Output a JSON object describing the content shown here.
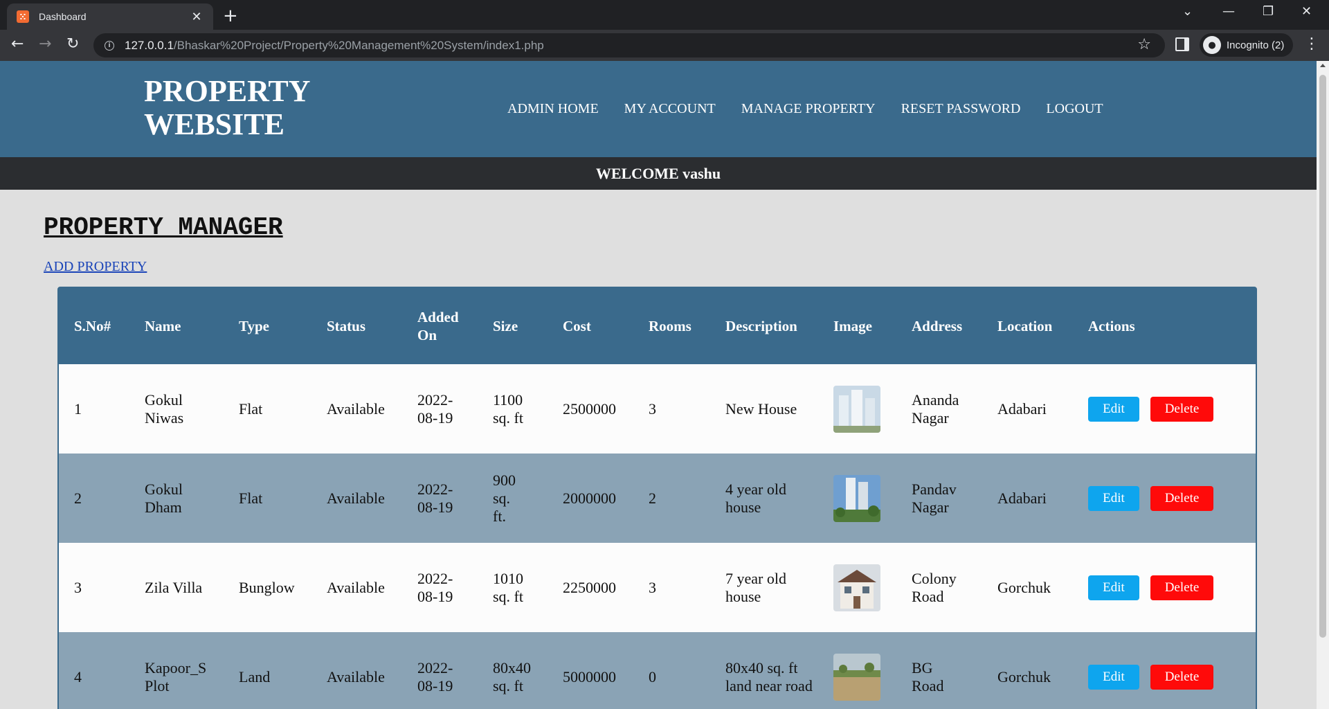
{
  "browser": {
    "tab_title": "Dashboard",
    "tab_favicon": "xampp-icon",
    "url_host": "127.0.0.1",
    "url_path": "/Bhaskar%20Project/Property%20Management%20System/index1.php",
    "incognito_label": "Incognito (2)"
  },
  "header": {
    "logo_line1": "PROPERTY",
    "logo_line2": "WEBSITE",
    "nav": [
      "ADMIN HOME",
      "MY ACCOUNT",
      "MANAGE PROPERTY",
      "RESET PASSWORD",
      "LOGOUT"
    ]
  },
  "welcome": "WELCOME vashu",
  "page": {
    "heading": "PROPERTY MANAGER",
    "add_link": "ADD PROPERTY"
  },
  "table": {
    "headers": [
      "S.No#",
      "Name",
      "Type",
      "Status",
      "Added On",
      "Size",
      "Cost",
      "Rooms",
      "Description",
      "Image",
      "Address",
      "Location",
      "Actions"
    ],
    "edit_label": "Edit",
    "delete_label": "Delete",
    "rows": [
      {
        "sno": "1",
        "name": "Gokul Niwas",
        "type": "Flat",
        "status": "Available",
        "added": "2022-08-19",
        "size": "1100 sq. ft",
        "cost": "2500000",
        "rooms": "3",
        "description": "New House",
        "address": "Ananda Nagar",
        "location": "Adabari"
      },
      {
        "sno": "2",
        "name": "Gokul Dham",
        "type": "Flat",
        "status": "Available",
        "added": "2022-08-19",
        "size": "900 sq. ft.",
        "cost": "2000000",
        "rooms": "2",
        "description": "4 year old house",
        "address": "Pandav Nagar",
        "location": "Adabari"
      },
      {
        "sno": "3",
        "name": "Zila Villa",
        "type": "Bunglow",
        "status": "Available",
        "added": "2022-08-19",
        "size": "1010 sq. ft",
        "cost": "2250000",
        "rooms": "3",
        "description": "7 year old house",
        "address": "Colony Road",
        "location": "Gorchuk"
      },
      {
        "sno": "4",
        "name": "Kapoor_S Plot",
        "type": "Land",
        "status": "Available",
        "added": "2022-08-19",
        "size": "80x40 sq. ft",
        "cost": "5000000",
        "rooms": "0",
        "description": "80x40 sq. ft land near road",
        "address": "BG Road",
        "location": "Gorchuk"
      }
    ]
  },
  "colors": {
    "header_blue": "#3a6a8c",
    "row_alt": "#8aa3b5",
    "edit_button": "#0ea5ee",
    "delete_button": "#ff0a0a"
  }
}
